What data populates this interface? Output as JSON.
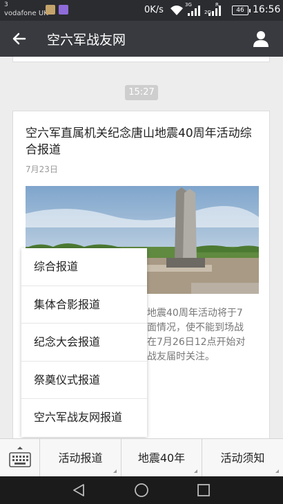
{
  "status_bar": {
    "sim_slot": "3",
    "carrier": "vodafone UK",
    "net_speed": "0K/s",
    "net_type_1": "3G",
    "net_type_2": "2G",
    "roaming": "R",
    "battery": "46",
    "time": "16:56"
  },
  "app_bar": {
    "title": "空六军战友网",
    "back_icon": "back-arrow-icon",
    "user_icon": "person-icon"
  },
  "chat": {
    "timestamp": "15:27",
    "article": {
      "title": "空六军直属机关纪念唐山地震40周年活动综合报道",
      "date": "7月23日",
      "desc_line1": "地震40周年活动将于7",
      "desc_line2": "面情况，使不能到场战",
      "desc_line3": "在7月26日12点开始对",
      "desc_line4": "战友届时关注。"
    }
  },
  "popup_menu": {
    "items": [
      "综合报道",
      "集体合影报道",
      "纪念大会报道",
      "祭奠仪式报道",
      "空六军战友网报道"
    ]
  },
  "bottom_menu": {
    "keyboard_icon": "keyboard-icon",
    "tabs": [
      "活动报道",
      "地震40年",
      "活动须知"
    ]
  },
  "nav_bar": {
    "icons": [
      "back-triangle-icon",
      "home-circle-icon",
      "recents-square-icon"
    ]
  },
  "colors": {
    "status_bar": "#2b2c30",
    "app_bar": "#393a3f",
    "background": "#ededed",
    "navbar": "#1b1b1b"
  }
}
